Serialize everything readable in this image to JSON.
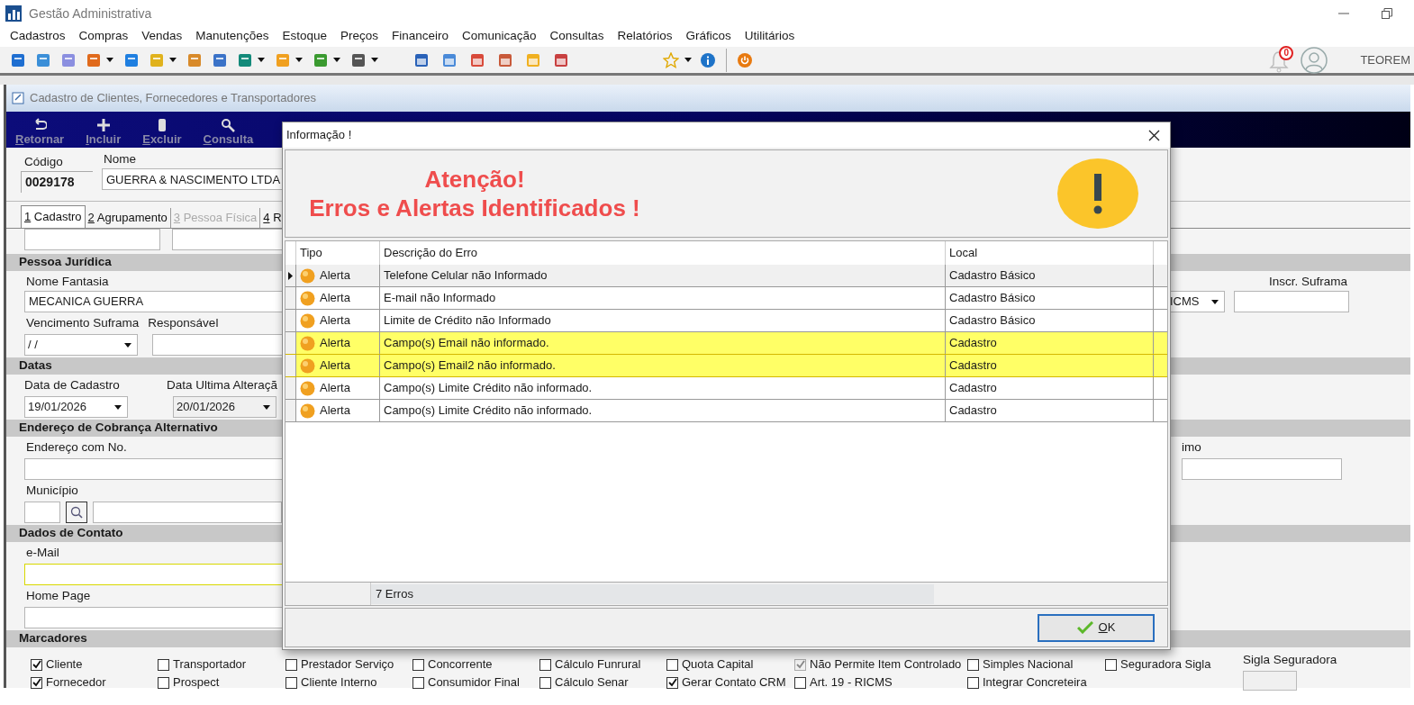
{
  "app": {
    "title": "Gestão Administrativa",
    "menu": [
      "Cadastros",
      "Compras",
      "Vendas",
      "Manutenções",
      "Estoque",
      "Preços",
      "Financeiro",
      "Comunicação",
      "Consultas",
      "Relatórios",
      "Gráficos",
      "Utilitários"
    ],
    "notifications": "0",
    "user": "TEOREM"
  },
  "form": {
    "title": "Cadastro de Clientes, Fornecedores e Transportadores",
    "toolbar": [
      "Retornar",
      "Incluir",
      "Excluir",
      "Consulta"
    ],
    "codigo_label": "Código",
    "codigo": "0029178",
    "nome_label": "Nome",
    "nome": "GUERRA & NASCIMENTO LTDA",
    "tabs": [
      {
        "label": "1 Cadastro",
        "selected": true,
        "disabled": false
      },
      {
        "label": "2 Agrupamento",
        "selected": false,
        "disabled": false
      },
      {
        "label": "3 Pessoa Física",
        "selected": false,
        "disabled": true
      },
      {
        "label": "4 R",
        "selected": false,
        "disabled": false
      }
    ],
    "pessoa_juridica": {
      "title": "Pessoa Jurídica",
      "nome_fantasia_label": "Nome Fantasia",
      "nome_fantasia": "MECANICA GUERRA",
      "inscr_suframa_label": "Inscr. Suframa",
      "icms_combo": "ICMS",
      "vencimento_label": "Vencimento Suframa",
      "vencimento": "/ /",
      "responsavel_label": "Responsável"
    },
    "datas": {
      "title": "Datas",
      "cadastro_label": "Data de Cadastro",
      "cadastro": "19/01/2026",
      "alteracao_label": "Data Ultima Alteraçã",
      "alteracao": "20/01/2026"
    },
    "endereco": {
      "title": "Endereço de Cobrança Alternativo",
      "endereco_label": "Endereço com No.",
      "right_label": "imo",
      "municipio_label": "Município"
    },
    "contato": {
      "title": "Dados de Contato",
      "email_label": "e-Mail",
      "homepage_label": "Home Page"
    },
    "marcadores": {
      "title": "Marcadores",
      "sigla_label": "Sigla Seguradora",
      "items": [
        {
          "label": "Cliente",
          "checked": true,
          "disabled": false
        },
        {
          "label": "Transportador",
          "checked": false,
          "disabled": false
        },
        {
          "label": "Prestador Serviço",
          "checked": false,
          "disabled": false
        },
        {
          "label": "Concorrente",
          "checked": false,
          "disabled": false
        },
        {
          "label": "Cálculo Funrural",
          "checked": false,
          "disabled": false
        },
        {
          "label": "Quota Capital",
          "checked": false,
          "disabled": false
        },
        {
          "label": "Não Permite Item Controlado",
          "checked": true,
          "disabled": true
        },
        {
          "label": "Simples Nacional",
          "checked": false,
          "disabled": false
        },
        {
          "label": "Seguradora Sigla",
          "checked": false,
          "disabled": false
        },
        {
          "label": "Fornecedor",
          "checked": true,
          "disabled": false
        },
        {
          "label": "Prospect",
          "checked": false,
          "disabled": false
        },
        {
          "label": "Cliente Interno",
          "checked": false,
          "disabled": false
        },
        {
          "label": "Consumidor Final",
          "checked": false,
          "disabled": false
        },
        {
          "label": "Cálculo Senar",
          "checked": false,
          "disabled": false
        },
        {
          "label": "Gerar Contato CRM",
          "checked": true,
          "disabled": false
        },
        {
          "label": "Art. 19 - RICMS",
          "checked": false,
          "disabled": false
        },
        {
          "label": "Integrar Concreteira",
          "checked": false,
          "disabled": false
        }
      ]
    }
  },
  "dialog": {
    "title": "Informação !",
    "heading": [
      "Atenção!",
      "Erros e Alertas Identificados !"
    ],
    "columns": [
      "Tipo",
      "Descrição do Erro",
      "Local"
    ],
    "rows": [
      {
        "tipo": "Alerta",
        "descricao": "Telefone Celular não Informado",
        "local": "Cadastro Básico",
        "selected": true,
        "highlighted": false
      },
      {
        "tipo": "Alerta",
        "descricao": "E-mail não Informado",
        "local": "Cadastro Básico",
        "selected": false,
        "highlighted": false
      },
      {
        "tipo": "Alerta",
        "descricao": "Limite de Crédito não Informado",
        "local": "Cadastro Básico",
        "selected": false,
        "highlighted": false
      },
      {
        "tipo": "Alerta",
        "descricao": "Campo(s) Email não informado.",
        "local": "Cadastro",
        "selected": false,
        "highlighted": true
      },
      {
        "tipo": "Alerta",
        "descricao": "Campo(s) Email2 não informado.",
        "local": "Cadastro",
        "selected": false,
        "highlighted": true
      },
      {
        "tipo": "Alerta",
        "descricao": "Campo(s) Limite Crédito não informado.",
        "local": "Cadastro",
        "selected": false,
        "highlighted": false
      },
      {
        "tipo": "Alerta",
        "descricao": "Campo(s) Limite Crédito não informado.",
        "local": "Cadastro",
        "selected": false,
        "highlighted": false
      }
    ],
    "footer": "7 Erros",
    "ok": "OK"
  }
}
